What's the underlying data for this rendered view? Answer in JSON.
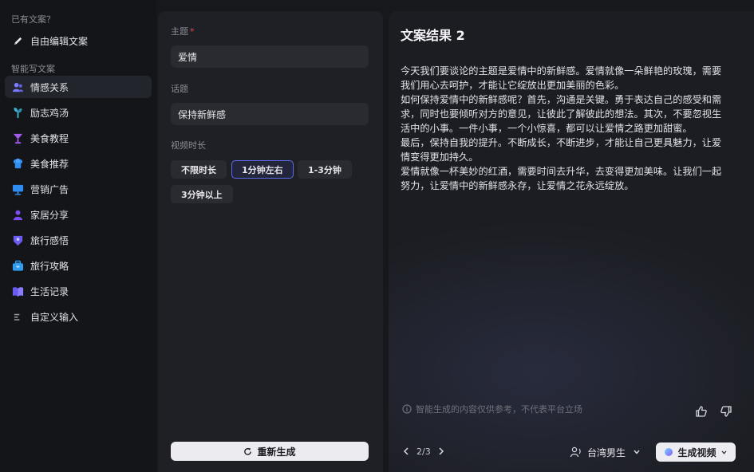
{
  "sidebar": {
    "section_existing": "已有文案？",
    "custom_edit": "自由编辑文案",
    "section_smart": "智能写文案",
    "items": [
      {
        "label": "情感关系",
        "icon": "people-icon",
        "color": "#7a7cff"
      },
      {
        "label": "励志鸡汤",
        "icon": "sprout-icon",
        "color": "#3fb6d0"
      },
      {
        "label": "美食教程",
        "icon": "cocktail-icon",
        "color": "#a45cf0"
      },
      {
        "label": "美食推荐",
        "icon": "chef-icon",
        "color": "#2f8cf0"
      },
      {
        "label": "营销广告",
        "icon": "monitor-icon",
        "color": "#2f8cf0"
      },
      {
        "label": "家居分享",
        "icon": "person-icon",
        "color": "#7b4cf0"
      },
      {
        "label": "旅行感悟",
        "icon": "map-pin-icon",
        "color": "#6a5cf0"
      },
      {
        "label": "旅行攻略",
        "icon": "briefcase-icon",
        "color": "#2f9cf0"
      },
      {
        "label": "生活记录",
        "icon": "book-icon",
        "color": "#6a5cf0"
      },
      {
        "label": "自定义输入",
        "icon": "text-lines-icon",
        "color": "#8b8d96"
      }
    ]
  },
  "form": {
    "theme_label": "主题",
    "theme_required": "*",
    "theme_value": "爱情",
    "topic_label": "话题",
    "topic_value": "保持新鲜感",
    "duration_label": "视频时长",
    "duration_options": [
      "不限时长",
      "1分钟左右",
      "1-3分钟",
      "3分钟以上"
    ],
    "duration_selected": "1分钟左右",
    "regenerate_label": "重新生成"
  },
  "result": {
    "title": "文案结果 2",
    "paragraphs": [
      "今天我们要谈论的主题是爱情中的新鲜感。爱情就像一朵鲜艳的玫瑰，需要我们用心去呵护，才能让它绽放出更加美丽的色彩。",
      "如何保持爱情中的新鲜感呢？首先，沟通是关键。勇于表达自己的感受和需求，同时也要倾听对方的意见，让彼此了解彼此的想法。其次，不要忽视生活中的小事。一件小事，一个小惊喜，都可以让爱情之路更加甜蜜。",
      "最后，保持自我的提升。不断成长，不断进步，才能让自己更具魅力，让爱情变得更加持久。",
      "爱情就像一杯美妙的红酒，需要时间去升华，去变得更加美味。让我们一起努力，让爱情中的新鲜感永存，让爱情之花永远绽放。"
    ],
    "disclaimer": "智能生成的内容仅供参考，不代表平台立场",
    "pager": "2/3",
    "voice": "台湾男生",
    "generate_video": "生成视频"
  },
  "colors": {
    "accent": "#5b6cf0",
    "required": "#e5484d"
  }
}
